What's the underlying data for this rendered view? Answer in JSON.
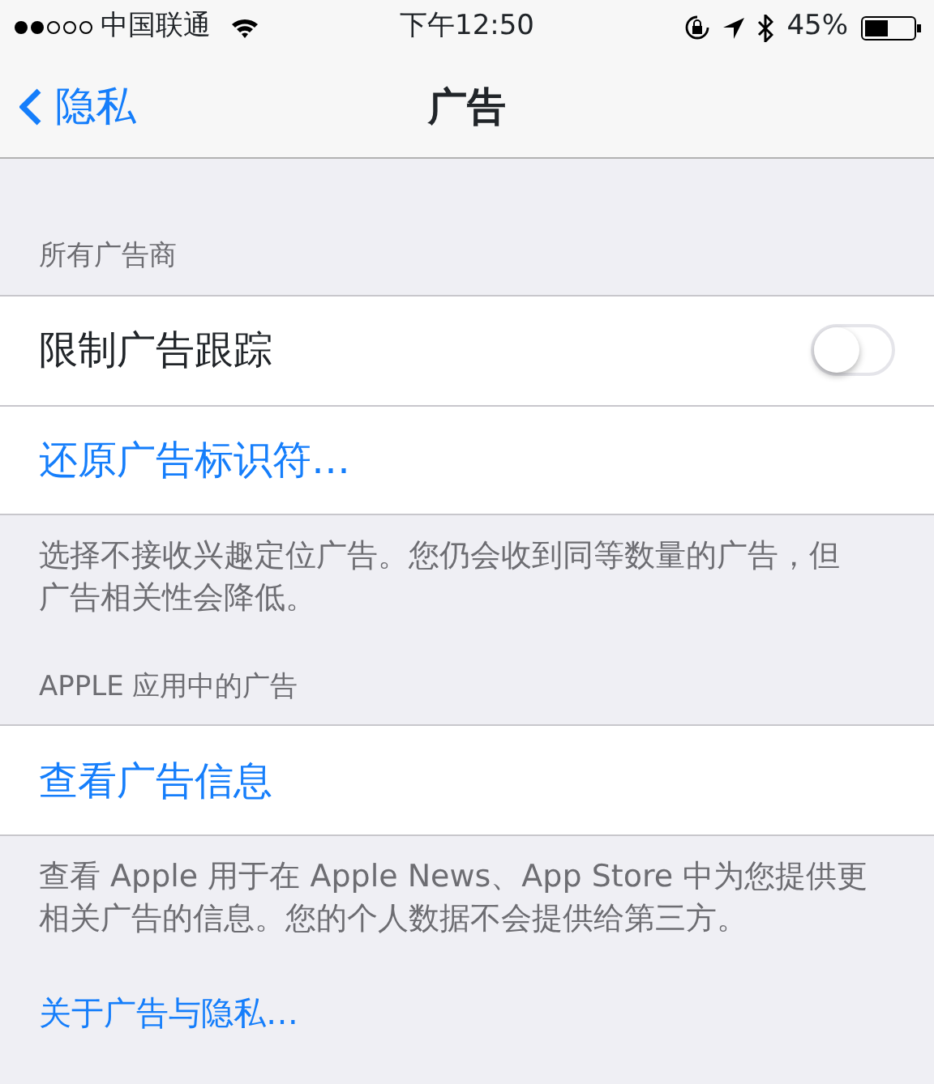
{
  "status_bar": {
    "carrier": "中国联通",
    "time": "下午12:50",
    "battery": "45%"
  },
  "nav": {
    "back": "隐私",
    "title": "广告"
  },
  "sections": [
    {
      "header": "所有广告商",
      "rows": [
        {
          "kind": "toggle",
          "label": "限制广告跟踪",
          "on": false
        },
        {
          "kind": "link",
          "label": "还原广告标识符…"
        }
      ],
      "footer": "选择不接收兴趣定位广告。您仍会收到同等数量的广告，但广告相关性会降低。"
    },
    {
      "header": "APPLE 应用中的广告",
      "rows": [
        {
          "kind": "link",
          "label": "查看广告信息"
        }
      ],
      "footer": "查看 Apple 用于在 Apple News、App Store 中为您提供更相关广告的信息。您的个人数据不会提供给第三方。"
    }
  ],
  "bottom_link": "关于广告与隐私…"
}
